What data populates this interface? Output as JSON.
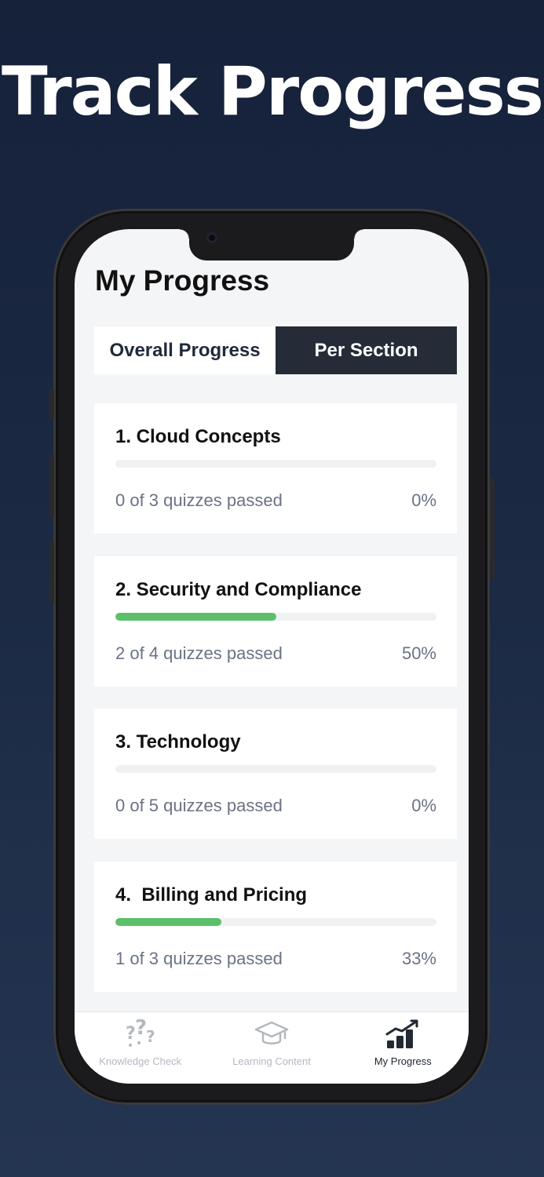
{
  "headline": "Track Progress",
  "screen": {
    "title": "My Progress",
    "segments": {
      "overall_label": "Overall Progress",
      "per_section_label": "Per Section",
      "selected": "Per Section"
    },
    "sections": [
      {
        "title": "1. Cloud Concepts",
        "status": "0 of 3 quizzes passed",
        "percent_text": "0%",
        "progress": 0
      },
      {
        "title": "2. Security and Compliance",
        "status": "2 of 4 quizzes passed",
        "percent_text": "50%",
        "progress": 50
      },
      {
        "title": "3. Technology",
        "status": "0 of 5 quizzes passed",
        "percent_text": "0%",
        "progress": 0
      },
      {
        "title": "4.  Billing and Pricing",
        "status": "1 of 3 quizzes passed",
        "percent_text": "33%",
        "progress": 33
      }
    ],
    "tabbar": {
      "knowledge_check": {
        "label": "Knowledge Check",
        "icon": "question-marks-icon"
      },
      "learning_content": {
        "label": "Learning Content",
        "icon": "graduation-cap-icon"
      },
      "my_progress": {
        "label": "My Progress",
        "icon": "bar-chart-trend-icon"
      },
      "active": "My Progress"
    }
  },
  "colors": {
    "progress_fill": "#5cc06a",
    "segment_active": "#252b37",
    "background_top": "#16213a",
    "background_bottom": "#243552"
  }
}
